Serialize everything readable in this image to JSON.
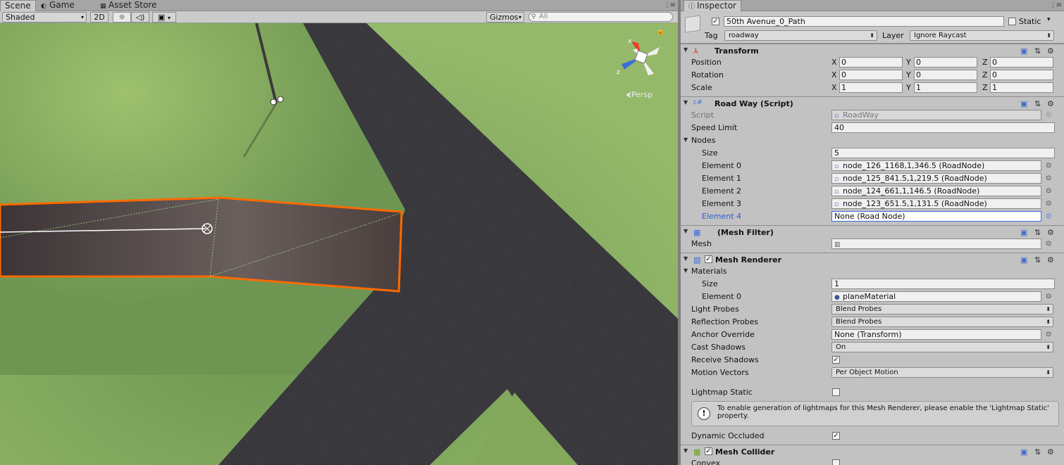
{
  "scene": {
    "tabs": [
      {
        "label": "Scene",
        "icon": "scene-icon"
      },
      {
        "label": "Game",
        "icon": "game-icon"
      },
      {
        "label": "Asset Store",
        "icon": "asset-store-icon"
      }
    ],
    "toolbar": {
      "shading": "Shaded",
      "mode_2d": "2D",
      "gizmos": "Gizmos",
      "search_placeholder": "All"
    },
    "persp_label": "Persp",
    "gizmo_axes": {
      "x": "x",
      "y": "y",
      "z": "z"
    }
  },
  "inspector": {
    "tab_label": "Inspector",
    "object": {
      "active": true,
      "name": "50th Avenue_0_Path",
      "static_label": "Static",
      "static": false,
      "tag_label": "Tag",
      "tag": "roadway",
      "layer_label": "Layer",
      "layer": "Ignore Raycast"
    },
    "transform": {
      "title": "Transform",
      "position": {
        "label": "Position",
        "x": "0",
        "y": "0",
        "z": "0"
      },
      "rotation": {
        "label": "Rotation",
        "x": "0",
        "y": "0",
        "z": "0"
      },
      "scale": {
        "label": "Scale",
        "x": "1",
        "y": "1",
        "z": "1"
      },
      "axis_labels": [
        "X",
        "Y",
        "Z"
      ]
    },
    "roadway": {
      "title": "Road Way (Script)",
      "script_label": "Script",
      "script": "RoadWay",
      "speed_limit_label": "Speed Limit",
      "speed_limit": "40",
      "nodes_label": "Nodes",
      "size_label": "Size",
      "size": "5",
      "elements": [
        {
          "label": "Element 0",
          "value": "node_126_1168,1,346.5 (RoadNode)"
        },
        {
          "label": "Element 1",
          "value": "node_125_841.5,1,219.5 (RoadNode)"
        },
        {
          "label": "Element 2",
          "value": "node_124_661,1,146.5 (RoadNode)"
        },
        {
          "label": "Element 3",
          "value": "node_123_651.5,1,131.5 (RoadNode)"
        },
        {
          "label": "Element 4",
          "value": "None (Road Node)"
        }
      ]
    },
    "mesh_filter": {
      "title": "(Mesh Filter)",
      "mesh_label": "Mesh",
      "mesh": ""
    },
    "mesh_renderer": {
      "enabled": true,
      "title": "Mesh Renderer",
      "materials_label": "Materials",
      "size_label": "Size",
      "size": "1",
      "element0_label": "Element 0",
      "element0": "planeMaterial",
      "light_probes_label": "Light Probes",
      "light_probes": "Blend Probes",
      "reflection_probes_label": "Reflection Probes",
      "reflection_probes": "Blend Probes",
      "anchor_override_label": "Anchor Override",
      "anchor_override": "None (Transform)",
      "cast_shadows_label": "Cast Shadows",
      "cast_shadows": "On",
      "receive_shadows_label": "Receive Shadows",
      "receive_shadows": true,
      "motion_vectors_label": "Motion Vectors",
      "motion_vectors": "Per Object Motion",
      "lightmap_static_label": "Lightmap Static",
      "lightmap_static": false,
      "help_text": "To enable generation of lightmaps for this Mesh Renderer, please enable the 'Lightmap Static' property.",
      "dynamic_occluded_label": "Dynamic Occluded",
      "dynamic_occluded": true
    },
    "mesh_collider": {
      "enabled": true,
      "title": "Mesh Collider",
      "convex_label": "Convex",
      "convex": false
    }
  },
  "colors": {
    "selection_outline": "#ff6a00",
    "road": "#3a393e",
    "grass": "#7fa85a",
    "field_highlight": "#3a6bd6"
  }
}
